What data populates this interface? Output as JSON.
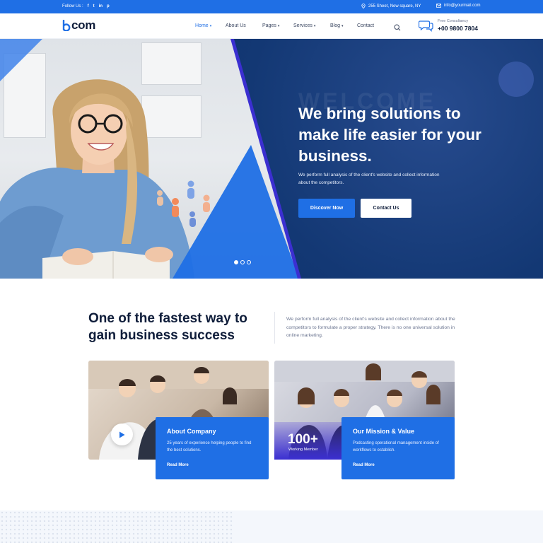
{
  "topbar": {
    "follow_label": "Follow Us :",
    "social": [
      "f",
      "t",
      "in",
      "p"
    ],
    "address": "255 Sheet, New square, NY",
    "email": "info@yourmail.com"
  },
  "header": {
    "logo_mark": "b",
    "logo_text": "com",
    "nav": [
      {
        "label": "Home",
        "dropdown": true,
        "active": true
      },
      {
        "label": "About Us",
        "dropdown": false
      },
      {
        "label": "Pages",
        "dropdown": true
      },
      {
        "label": "Services",
        "dropdown": true
      },
      {
        "label": "Blog",
        "dropdown": true
      },
      {
        "label": "Contact",
        "dropdown": false
      }
    ],
    "consult_label": "Free Consultancy",
    "consult_phone": "+00 9800 7804"
  },
  "hero": {
    "watermark": "WELCOME",
    "title": "We bring solutions to make life easier for your business.",
    "subtitle": "We perform full analysis of the client's website and collect information about the competitors.",
    "primary_button": "Discover Now",
    "secondary_button": "Contact Us",
    "slides": 3,
    "active_slide": 1
  },
  "intro": {
    "title": "One of the fastest way to gain business success",
    "text": "We perform full analysis of the client's website and collect information about the competitors to formulate a proper strategy. There is no one universal solution in online marketing."
  },
  "cards": [
    {
      "title": "About Company",
      "text": "25 years of experience helping people to find the best solutions.",
      "link": "Read More"
    },
    {
      "title": "Our Mission & Value",
      "text": "Podcasting operational management inside of workflows to establish.",
      "link": "Read More"
    }
  ],
  "stat": {
    "number": "100+",
    "label": "Working Member"
  },
  "colors": {
    "primary": "#1f6fe5",
    "dark": "#0f1d3a",
    "hero_dark": "#0b2761",
    "accent_violet": "#3b2fd1"
  }
}
